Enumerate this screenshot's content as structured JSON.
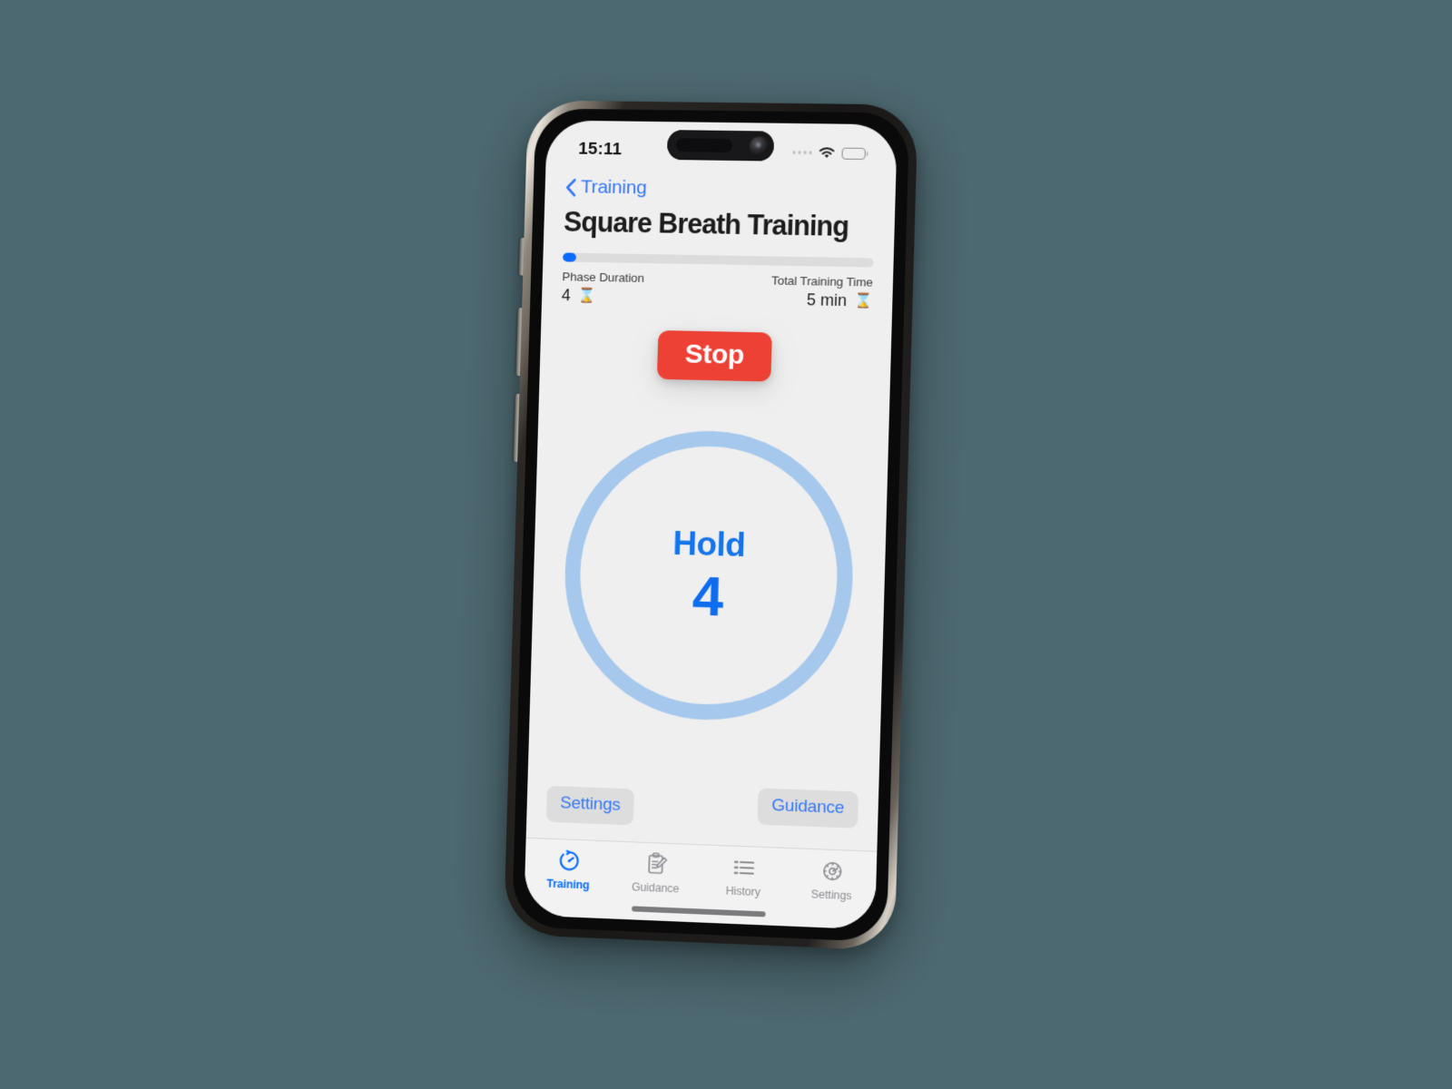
{
  "background_color": "#4C6870",
  "device": {
    "name": "iPhone",
    "frame_color": "#2b2825"
  },
  "status_bar": {
    "time": "15:11",
    "cellular_icon": "cellular-dots-icon",
    "wifi_icon": "wifi-icon",
    "battery_icon": "battery-icon"
  },
  "nav": {
    "back_icon": "chevron-left-icon",
    "back_label": "Training"
  },
  "header": {
    "title": "Square Breath Training"
  },
  "progress": {
    "percent": 4.5
  },
  "meta": {
    "phase_duration_label": "Phase Duration",
    "phase_duration_value": "4",
    "phase_duration_icon": "hourglass-icon",
    "total_time_label": "Total Training Time",
    "total_time_value": "5 min",
    "total_time_icon": "hourglass-icon"
  },
  "controls": {
    "stop_label": "Stop",
    "stop_color": "#EE4136"
  },
  "breath": {
    "phase": "Hold",
    "count": "4",
    "ring_color": "#A6C8EC",
    "text_color": "#0E6CEF"
  },
  "pills": {
    "settings_label": "Settings",
    "guidance_label": "Guidance",
    "text_color": "#3478F6",
    "background": "#DDDDDD"
  },
  "tabs": [
    {
      "label": "Training",
      "icon": "timer-icon",
      "active": true
    },
    {
      "label": "Guidance",
      "icon": "clipboard-pencil-icon",
      "active": false
    },
    {
      "label": "History",
      "icon": "list-icon",
      "active": false
    },
    {
      "label": "Settings",
      "icon": "gear-icon",
      "active": false
    }
  ],
  "accent_color": "#0A6CFF"
}
